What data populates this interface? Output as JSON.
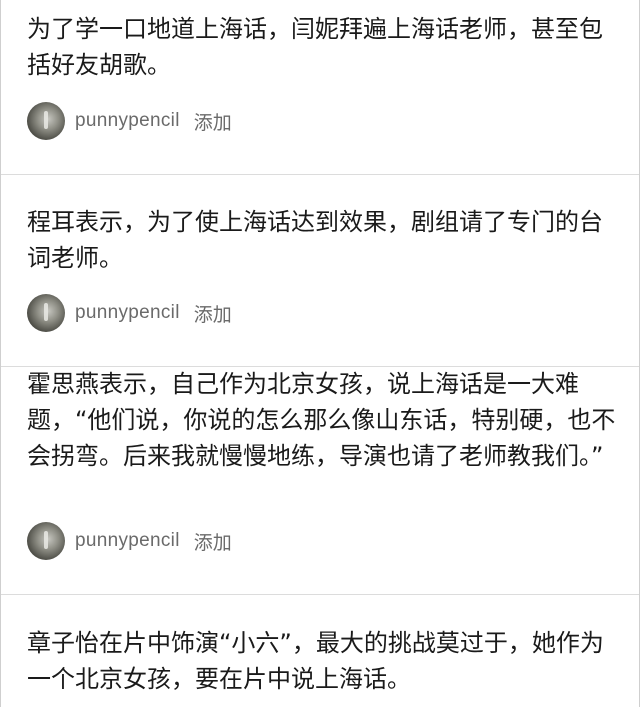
{
  "posts": [
    {
      "text": "为了学一口地道上海话，闫妮拜遍上海话老师，甚至包括好友胡歌。",
      "author": "punnypencil",
      "action": "添加"
    },
    {
      "text": "程耳表示，为了使上海话达到效果，剧组请了专门的台词老师。",
      "author": "punnypencil",
      "action": "添加"
    },
    {
      "text": "霍思燕表示，自己作为北京女孩，说上海话是一大难题，“他们说，你说的怎么那么像山东话，特别硬，也不会拐弯。后来我就慢慢地练，导演也请了老师教我们。”",
      "author": "punnypencil",
      "action": "添加"
    },
    {
      "text": "章子怡在片中饰演“小六”，最大的挑战莫过于，她作为一个北京女孩，要在片中说上海话。"
    }
  ]
}
